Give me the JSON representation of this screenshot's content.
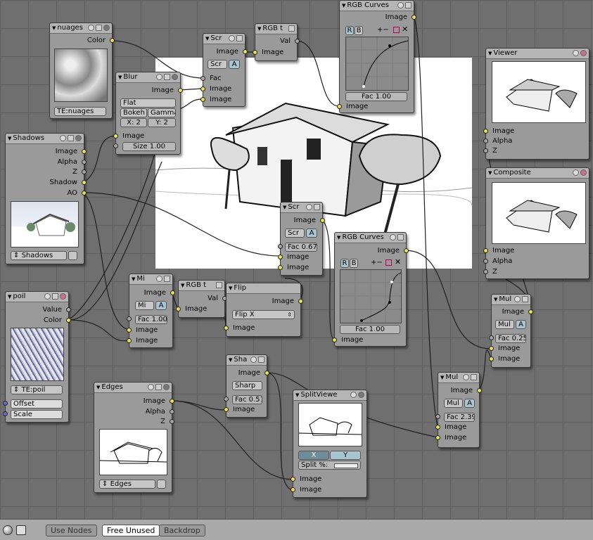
{
  "nodes": {
    "nuages": {
      "title": "nuages",
      "out_color": "Color",
      "texture": "TE:nuages"
    },
    "blur": {
      "title": "Blur",
      "out_image": "Image",
      "filter": "Flat",
      "bokeh": "Bokeh",
      "gamma": "Gamma",
      "x": "X: 2",
      "y": "Y: 2",
      "in_image": "Image",
      "size": "Size 1.00"
    },
    "scr1": {
      "title": "Scr",
      "out_image": "Image",
      "mode": "Scr",
      "alpha": "A",
      "in_fac": "Fac",
      "in_image1": "Image",
      "in_image2": "Image"
    },
    "rgbt1": {
      "title": "RGB t",
      "out_val": "Val",
      "in_image": "Image"
    },
    "curves1": {
      "title": "RGB Curves",
      "out_image": "Image",
      "btn_r": "R",
      "btn_b": "B",
      "fac": "Fac 1.00",
      "in_image": "Image"
    },
    "viewer": {
      "title": "Viewer",
      "in_image": "Image",
      "in_alpha": "Alpha",
      "in_z": "Z"
    },
    "shadows": {
      "title": "Shadows",
      "out_image": "Image",
      "out_alpha": "Alpha",
      "out_z": "Z",
      "out_shadow": "Shadow",
      "out_ao": "AO",
      "layer": "Shadows"
    },
    "composite": {
      "title": "Composite",
      "in_image": "Image",
      "in_alpha": "Alpha",
      "in_z": "Z"
    },
    "scr2": {
      "title": "Scr",
      "out_image": "Image",
      "mode": "Scr",
      "alpha": "A",
      "fac": "Fac 0.67",
      "in_image1": "Image",
      "in_image2": "Image"
    },
    "curves2": {
      "title": "RGB Curves",
      "out_image": "Image",
      "btn_r": "R",
      "btn_b": "B",
      "fac": "Fac 1.00",
      "in_image": "Image"
    },
    "poil": {
      "title": "poil",
      "out_value": "Value",
      "out_color": "Color",
      "texture": "TE:poil",
      "in_offset": "Offset",
      "in_scale": "Scale"
    },
    "mi": {
      "title": "Mi",
      "out_image": "Image",
      "mode": "Mi",
      "alpha": "A",
      "fac": "Fac 1.00",
      "in_image1": "Image",
      "in_image2": "Image"
    },
    "rgbt2": {
      "title": "RGB t",
      "out_val": "Val",
      "in_image": "Image"
    },
    "flip": {
      "title": "Flip",
      "out_image": "Image",
      "axis": "Flip X",
      "in_image": "Image"
    },
    "mul1": {
      "title": "Mul",
      "out_image": "Image",
      "mode": "Mul",
      "alpha": "A",
      "fac": "Fac 0.25",
      "in_image1": "Image",
      "in_image2": "Image"
    },
    "sha": {
      "title": "Sha",
      "out_image": "Image",
      "mode": "Sharp",
      "fac": "Fac 0.51",
      "in_image": "Image"
    },
    "edges": {
      "title": "Edges",
      "out_image": "Image",
      "out_alpha": "Alpha",
      "out_z": "Z",
      "layer": "Edges"
    },
    "split": {
      "title": "SplitViewe",
      "x": "X",
      "y": "Y",
      "split": "Split %:",
      "in_image1": "Image",
      "in_image2": "Image"
    },
    "mul2": {
      "title": "Mul",
      "out_image": "Image",
      "mode": "Mul",
      "alpha": "A",
      "fac": "Fac 2.39",
      "in_image1": "Image",
      "in_image2": "Image"
    }
  },
  "toolbar": {
    "use_nodes": "Use Nodes",
    "free_unused": "Free Unused",
    "backdrop": "Backdrop"
  },
  "colors": {
    "socket_color": "#e8e34c",
    "socket_value": "#a6a6a6",
    "socket_vector": "#6a6ad4",
    "node_body": "#9a9a9a",
    "node_header": "#b5b5b5",
    "grid": "#5f5f5f"
  },
  "icons": [
    "collapse-triangle-icon",
    "node-preview-icon",
    "node-menu-icon",
    "node-hide-icon",
    "curve-zoom-icon",
    "curve-clip-icon",
    "curve-delete-icon",
    "sphere-view-icon",
    "node-editor-icon"
  ]
}
